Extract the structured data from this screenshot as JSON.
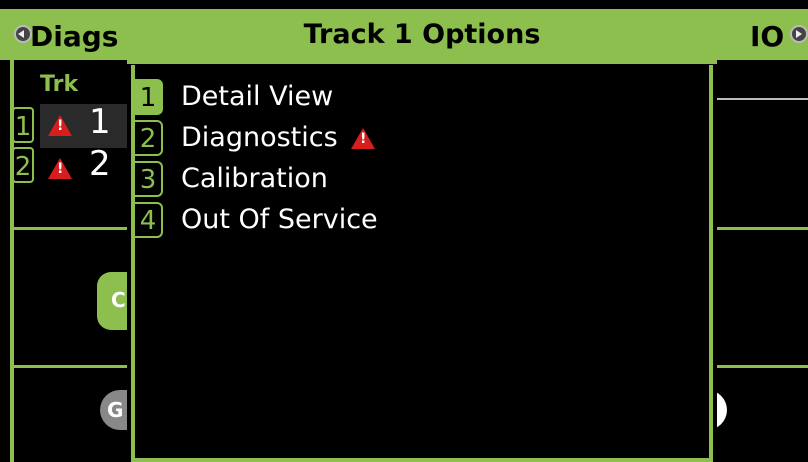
{
  "background_tabs": {
    "left_title": "Diags",
    "right_title": "IO",
    "track_header": "Trk",
    "tracks": [
      {
        "index": "1",
        "number": "1"
      },
      {
        "index": "2",
        "number": "2"
      }
    ],
    "partial_button_1": "C",
    "partial_button_2": "G"
  },
  "modal": {
    "title": "Track 1 Options",
    "options": [
      {
        "index": "1",
        "label": "Detail View",
        "warning": false,
        "selected": true
      },
      {
        "index": "2",
        "label": "Diagnostics",
        "warning": true,
        "selected": false
      },
      {
        "index": "3",
        "label": "Calibration",
        "warning": false,
        "selected": false
      },
      {
        "index": "4",
        "label": "Out Of Service",
        "warning": false,
        "selected": false
      }
    ]
  },
  "colors": {
    "accent": "#8dbf4f",
    "warning": "#d71d1d",
    "background": "#000000"
  }
}
